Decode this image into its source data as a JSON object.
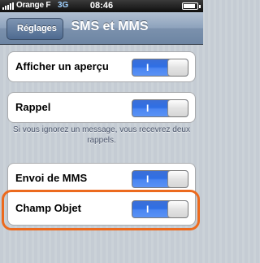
{
  "status_bar": {
    "carrier": "Orange F",
    "network": "3G",
    "time": "08:46"
  },
  "nav": {
    "back_label": "Réglages",
    "title": "SMS et MMS"
  },
  "settings": [
    {
      "label": "Afficher un aperçu",
      "toggle_text": "I",
      "state": "on"
    },
    {
      "label": "Rappel",
      "toggle_text": "I",
      "state": "on"
    },
    {
      "label": "Envoi de MMS",
      "toggle_text": "I",
      "state": "on"
    },
    {
      "label": "Champ Objet",
      "toggle_text": "I",
      "state": "on"
    }
  ],
  "rappel_footnote": "Si vous ignorez un message, vous recevrez deux rappels.",
  "colors": {
    "toggle_on": "#2f6fe5",
    "highlight": "#ec6a1e",
    "nav_bar": "#6d85a3"
  }
}
